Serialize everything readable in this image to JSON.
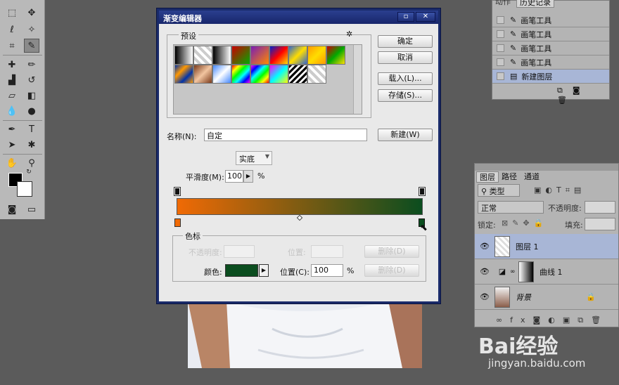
{
  "dialog": {
    "title": "渐变编辑器",
    "presets_label": "预设",
    "ok": "确定",
    "cancel": "取消",
    "load": "载入(L)...",
    "save": "存储(S)...",
    "name_label": "名称(N):",
    "name_value": "自定",
    "new_button": "新建(W)",
    "type_value": "实底",
    "smooth_label": "平滑度(M):",
    "smooth_value": "100",
    "smooth_unit": "%",
    "stops_label": "色标",
    "opacity_label": "不透明度:",
    "location_label": "位置:",
    "delete_label": "删除(D)",
    "color_label": "颜色:",
    "color_value": "#0b4d1f",
    "position_label": "位置(C):",
    "position_value": "100",
    "position_unit": "%",
    "gradient_start": "#f06a05",
    "gradient_end": "#0b4d1f",
    "minimize": "▫",
    "close": "✕"
  },
  "history": {
    "tab_actions": "动作",
    "tab_history": "历史记录",
    "items": [
      "画笔工具",
      "画笔工具",
      "画笔工具",
      "画笔工具",
      "新建图层"
    ]
  },
  "layers": {
    "tabs": [
      "图层",
      "路径",
      "通道"
    ],
    "kind": "类型",
    "blend": "正常",
    "opacity_label": "不透明度:",
    "lock_label": "锁定:",
    "fill_label": "填充:",
    "rows": [
      "图层 1",
      "曲线 1",
      "背景"
    ]
  },
  "watermark": {
    "brand": "Bai经验",
    "url": "jingyan.baidu.com"
  }
}
